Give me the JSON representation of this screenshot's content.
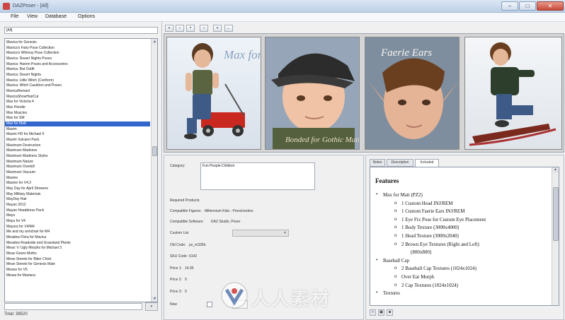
{
  "window": {
    "title": "DAZPoser - [All]",
    "controls": [
      "–",
      "□",
      "✕"
    ]
  },
  "menu": [
    "File",
    "View",
    "Database",
    "Options"
  ],
  "left": {
    "search_value": "[All]",
    "items": [
      "Mavica for Genesis",
      "Mavica's Fairy Pose Collection",
      "Mavica's Whimsy Pose Collection",
      "Mavica: Desert Nights Poses",
      "Mavica: Harem Poses and Accessories",
      "Mavica: Bat Outfit",
      "Mavica: Desert Nights",
      "Mavica: Little Witch (Conform)",
      "Mavica: Witch Cauldron and Poses",
      "MavicaRemast",
      "MavicaShowHairCut",
      "Max for Victoria 4",
      "Max Hoodie",
      "Max Muscles",
      "Max for SM",
      "Max for Matt",
      "Maxim",
      "Maxim HD for Michael 6",
      "Maxim Vulcano Pack",
      "Maximum Destruction",
      "Maximum Madness",
      "Maximum Madness Styles",
      "Maximum Nature",
      "Maximum Overkill",
      "Maximum Vacuum",
      "Maxine",
      "Maxine for V4.2",
      "May Day for April Showers",
      "May Military Materials",
      "MayDay Hair",
      "Mayan 2012",
      "Mayan Headdress Pack",
      "Mayo",
      "Mayu for V4",
      "Mayura for V4/M4",
      "Me and my armchair for M4",
      "Meadow Flora for Mavica",
      "Meadow Roadside and Grassland Plants",
      "Mean 'n' Ugly Morphs for Michael 3",
      "Mean Green Moths",
      "Mean Streets for Biker Chick",
      "Mean Streets for Genesis Male",
      "Means for V5",
      "Meara for Mariana"
    ],
    "selected_index": 15,
    "search_button": "⌕",
    "status": "Total: 38520"
  },
  "nav_buttons": [
    "«",
    "‹",
    "•",
    "›",
    "»",
    "←"
  ],
  "thumbs": [
    {
      "caption": "Max for Matt"
    },
    {
      "caption": "Bonded for Gothic Matt"
    },
    {
      "caption": "Faerie Ears"
    },
    {
      "caption": ""
    }
  ],
  "details": {
    "category_label": "Category:",
    "category_value": "Fun People:Children",
    "required_label": "Required Products:",
    "figures_label": "Compatible Figures:",
    "figures_value": "Millennium Kids - Preschoolers",
    "software_label": "Compatible Software:",
    "software_value": "DAZ Studio, Poser",
    "custom_label": "Custom List",
    "old_code_label": "Old Code:",
    "old_code_value": "pz_m335b",
    "sku_label": "SKU Code:",
    "sku_value": "6142",
    "price1_label": "Price 1:",
    "price1_value": "14.95",
    "price2_label": "Price 2:",
    "price2_value": "0",
    "price3_label": "Price 3:",
    "price3_value": "0",
    "new_label": "New"
  },
  "info": {
    "tabs": [
      "Notes",
      "Description",
      "Included"
    ],
    "active_tab": 2,
    "title": "Features",
    "lines": [
      {
        "level": 1,
        "text": "Max for Matt (PZ2)"
      },
      {
        "level": 2,
        "text": "1 Custom Head INJ/REM"
      },
      {
        "level": 2,
        "text": "1 Custom Faerie Ears INJ/REM"
      },
      {
        "level": 2,
        "text": "1 Eye Fix Pose for Custom Eye Placement"
      },
      {
        "level": 2,
        "text": "1 Body Texture (3000x4000)"
      },
      {
        "level": 2,
        "text": "1 Head Texture (3000x2040)"
      },
      {
        "level": 2,
        "text": "2 Brown Eye Textures (Right and Left)"
      },
      {
        "level": 3,
        "text": "(800x800)"
      },
      {
        "level": 1,
        "text": "Baseball Cap"
      },
      {
        "level": 2,
        "text": "2 Baseball Cap Textures (1024x1024)"
      },
      {
        "level": 2,
        "text": "Over Ear Morph"
      },
      {
        "level": 2,
        "text": "2 Cap Textures (1024x1024)"
      },
      {
        "level": 1,
        "text": "Textures"
      }
    ],
    "bottom_buttons": [
      "□",
      "▣",
      "■"
    ]
  },
  "watermark": {
    "text": "人人素材"
  },
  "colors": {
    "selection": "#3366cc",
    "titlebar": "#c6d7ec"
  }
}
